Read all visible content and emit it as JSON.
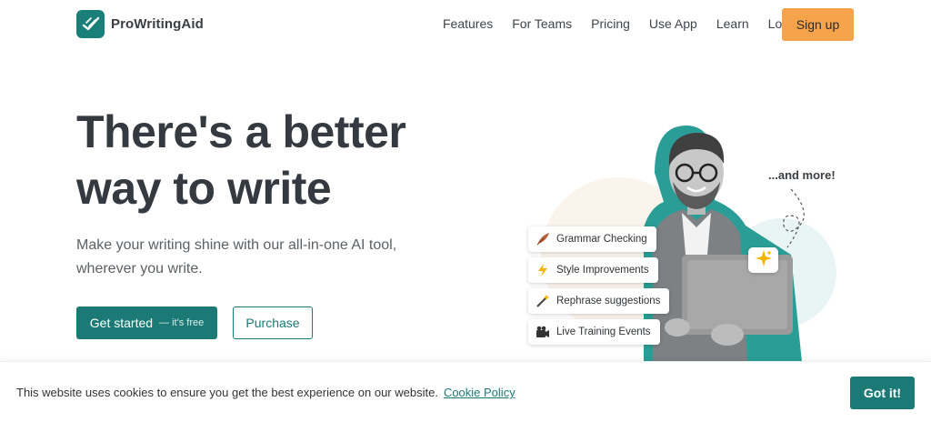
{
  "brand": {
    "name": "ProWritingAid",
    "logo_icon": "check-feather-icon",
    "color": "#1b7f79"
  },
  "nav": {
    "links": [
      "Features",
      "For Teams",
      "Pricing",
      "Use App",
      "Learn",
      "Log in"
    ],
    "signup_label": "Sign up",
    "signup_color": "#f5a44c"
  },
  "hero": {
    "title": "There's a better way to write",
    "subtitle": "Make your writing shine with our all-in-one AI tool, wherever you write.",
    "cta_primary": {
      "label": "Get started",
      "note": "— it's free"
    },
    "cta_secondary": {
      "label": "Purchase"
    }
  },
  "illustration": {
    "features": [
      {
        "label": "Grammar Checking",
        "icon": "quill-icon"
      },
      {
        "label": "Style Improvements",
        "icon": "lightning-icon"
      },
      {
        "label": "Rephrase suggestions",
        "icon": "magic-wand-icon"
      },
      {
        "label": "Live Training Events",
        "icon": "video-camera-icon"
      }
    ],
    "more_label": "...and more!",
    "sparkle_icon": "sparkle-icon",
    "accent_color": "#2a9d96"
  },
  "cookie_bar": {
    "text": "This website uses cookies to ensure you get the best experience on our website.",
    "link_label": "Cookie Policy",
    "button_label": "Got it!"
  }
}
